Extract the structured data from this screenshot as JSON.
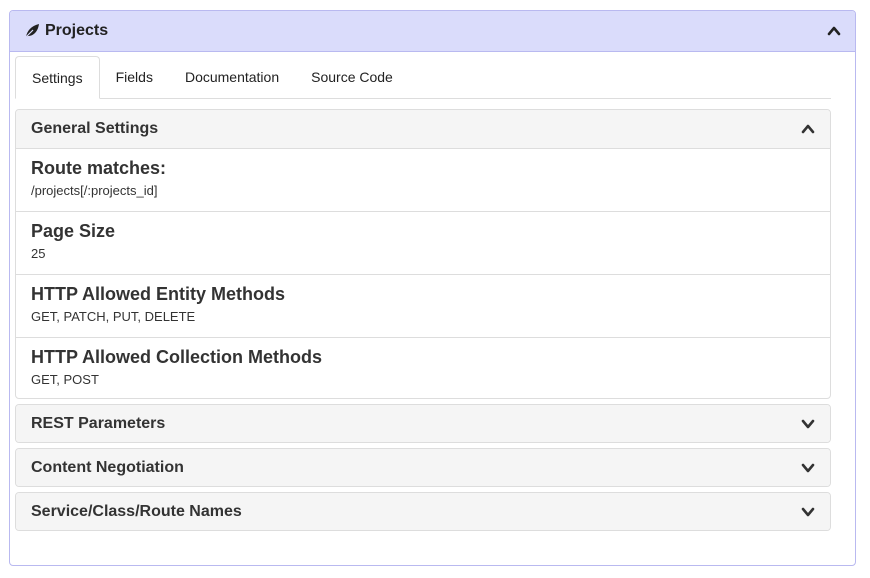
{
  "panel": {
    "title": "Projects"
  },
  "tabs": [
    {
      "label": "Settings"
    },
    {
      "label": "Fields"
    },
    {
      "label": "Documentation"
    },
    {
      "label": "Source Code"
    }
  ],
  "general_settings": {
    "title": "General Settings",
    "items": [
      {
        "label": "Route matches:",
        "value": "/projects[/:projects_id]"
      },
      {
        "label": "Page Size",
        "value": "25"
      },
      {
        "label": "HTTP Allowed Entity Methods",
        "value": "GET, PATCH, PUT, DELETE"
      },
      {
        "label": "HTTP Allowed Collection Methods",
        "value": "GET, POST"
      }
    ]
  },
  "sections": [
    {
      "title": "REST Parameters"
    },
    {
      "title": "Content Negotiation"
    },
    {
      "title": "Service/Class/Route Names"
    }
  ],
  "colors": {
    "heading_bg": "#dadcfb",
    "border": "#b9b9f0"
  },
  "icons": {
    "title_icon": "leaf-icon",
    "collapse": "chevron-up-icon",
    "expand": "chevron-down-icon"
  }
}
